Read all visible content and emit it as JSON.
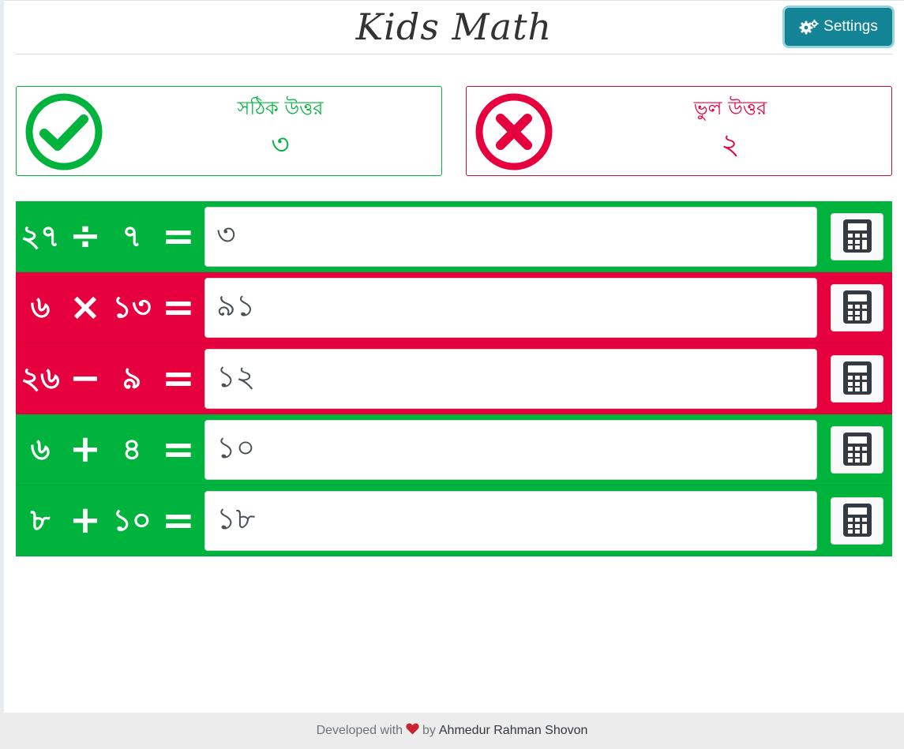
{
  "header": {
    "title": "Kids Math",
    "settings_label": "Settings",
    "settings_icon": "gears-icon"
  },
  "scores": {
    "correct": {
      "label": "সঠিক উত্তর",
      "value": "৩",
      "icon": "check-circle-icon",
      "color": "#00b33c"
    },
    "wrong": {
      "label": "ভুল উত্তর",
      "value": "২",
      "icon": "times-circle-icon",
      "color": "#e6003d"
    }
  },
  "problems": [
    {
      "a": "২৭",
      "op": "÷",
      "b": "৭",
      "eq": "=",
      "answer": "৩",
      "status": "correct"
    },
    {
      "a": "৬",
      "op": "×",
      "b": "১৩",
      "eq": "=",
      "answer": "৯১",
      "status": "wrong"
    },
    {
      "a": "২৬",
      "op": "−",
      "b": "৯",
      "eq": "=",
      "answer": "১২",
      "status": "wrong"
    },
    {
      "a": "৬",
      "op": "+",
      "b": "৪",
      "eq": "=",
      "answer": "১০",
      "status": "correct"
    },
    {
      "a": "৮",
      "op": "+",
      "b": "১০",
      "eq": "=",
      "answer": "১৮",
      "status": "correct"
    }
  ],
  "footer": {
    "developed_with": "Developed with",
    "heart_icon": "heart-icon",
    "by": "by",
    "author": "Ahmedur Rahman Shovon"
  }
}
